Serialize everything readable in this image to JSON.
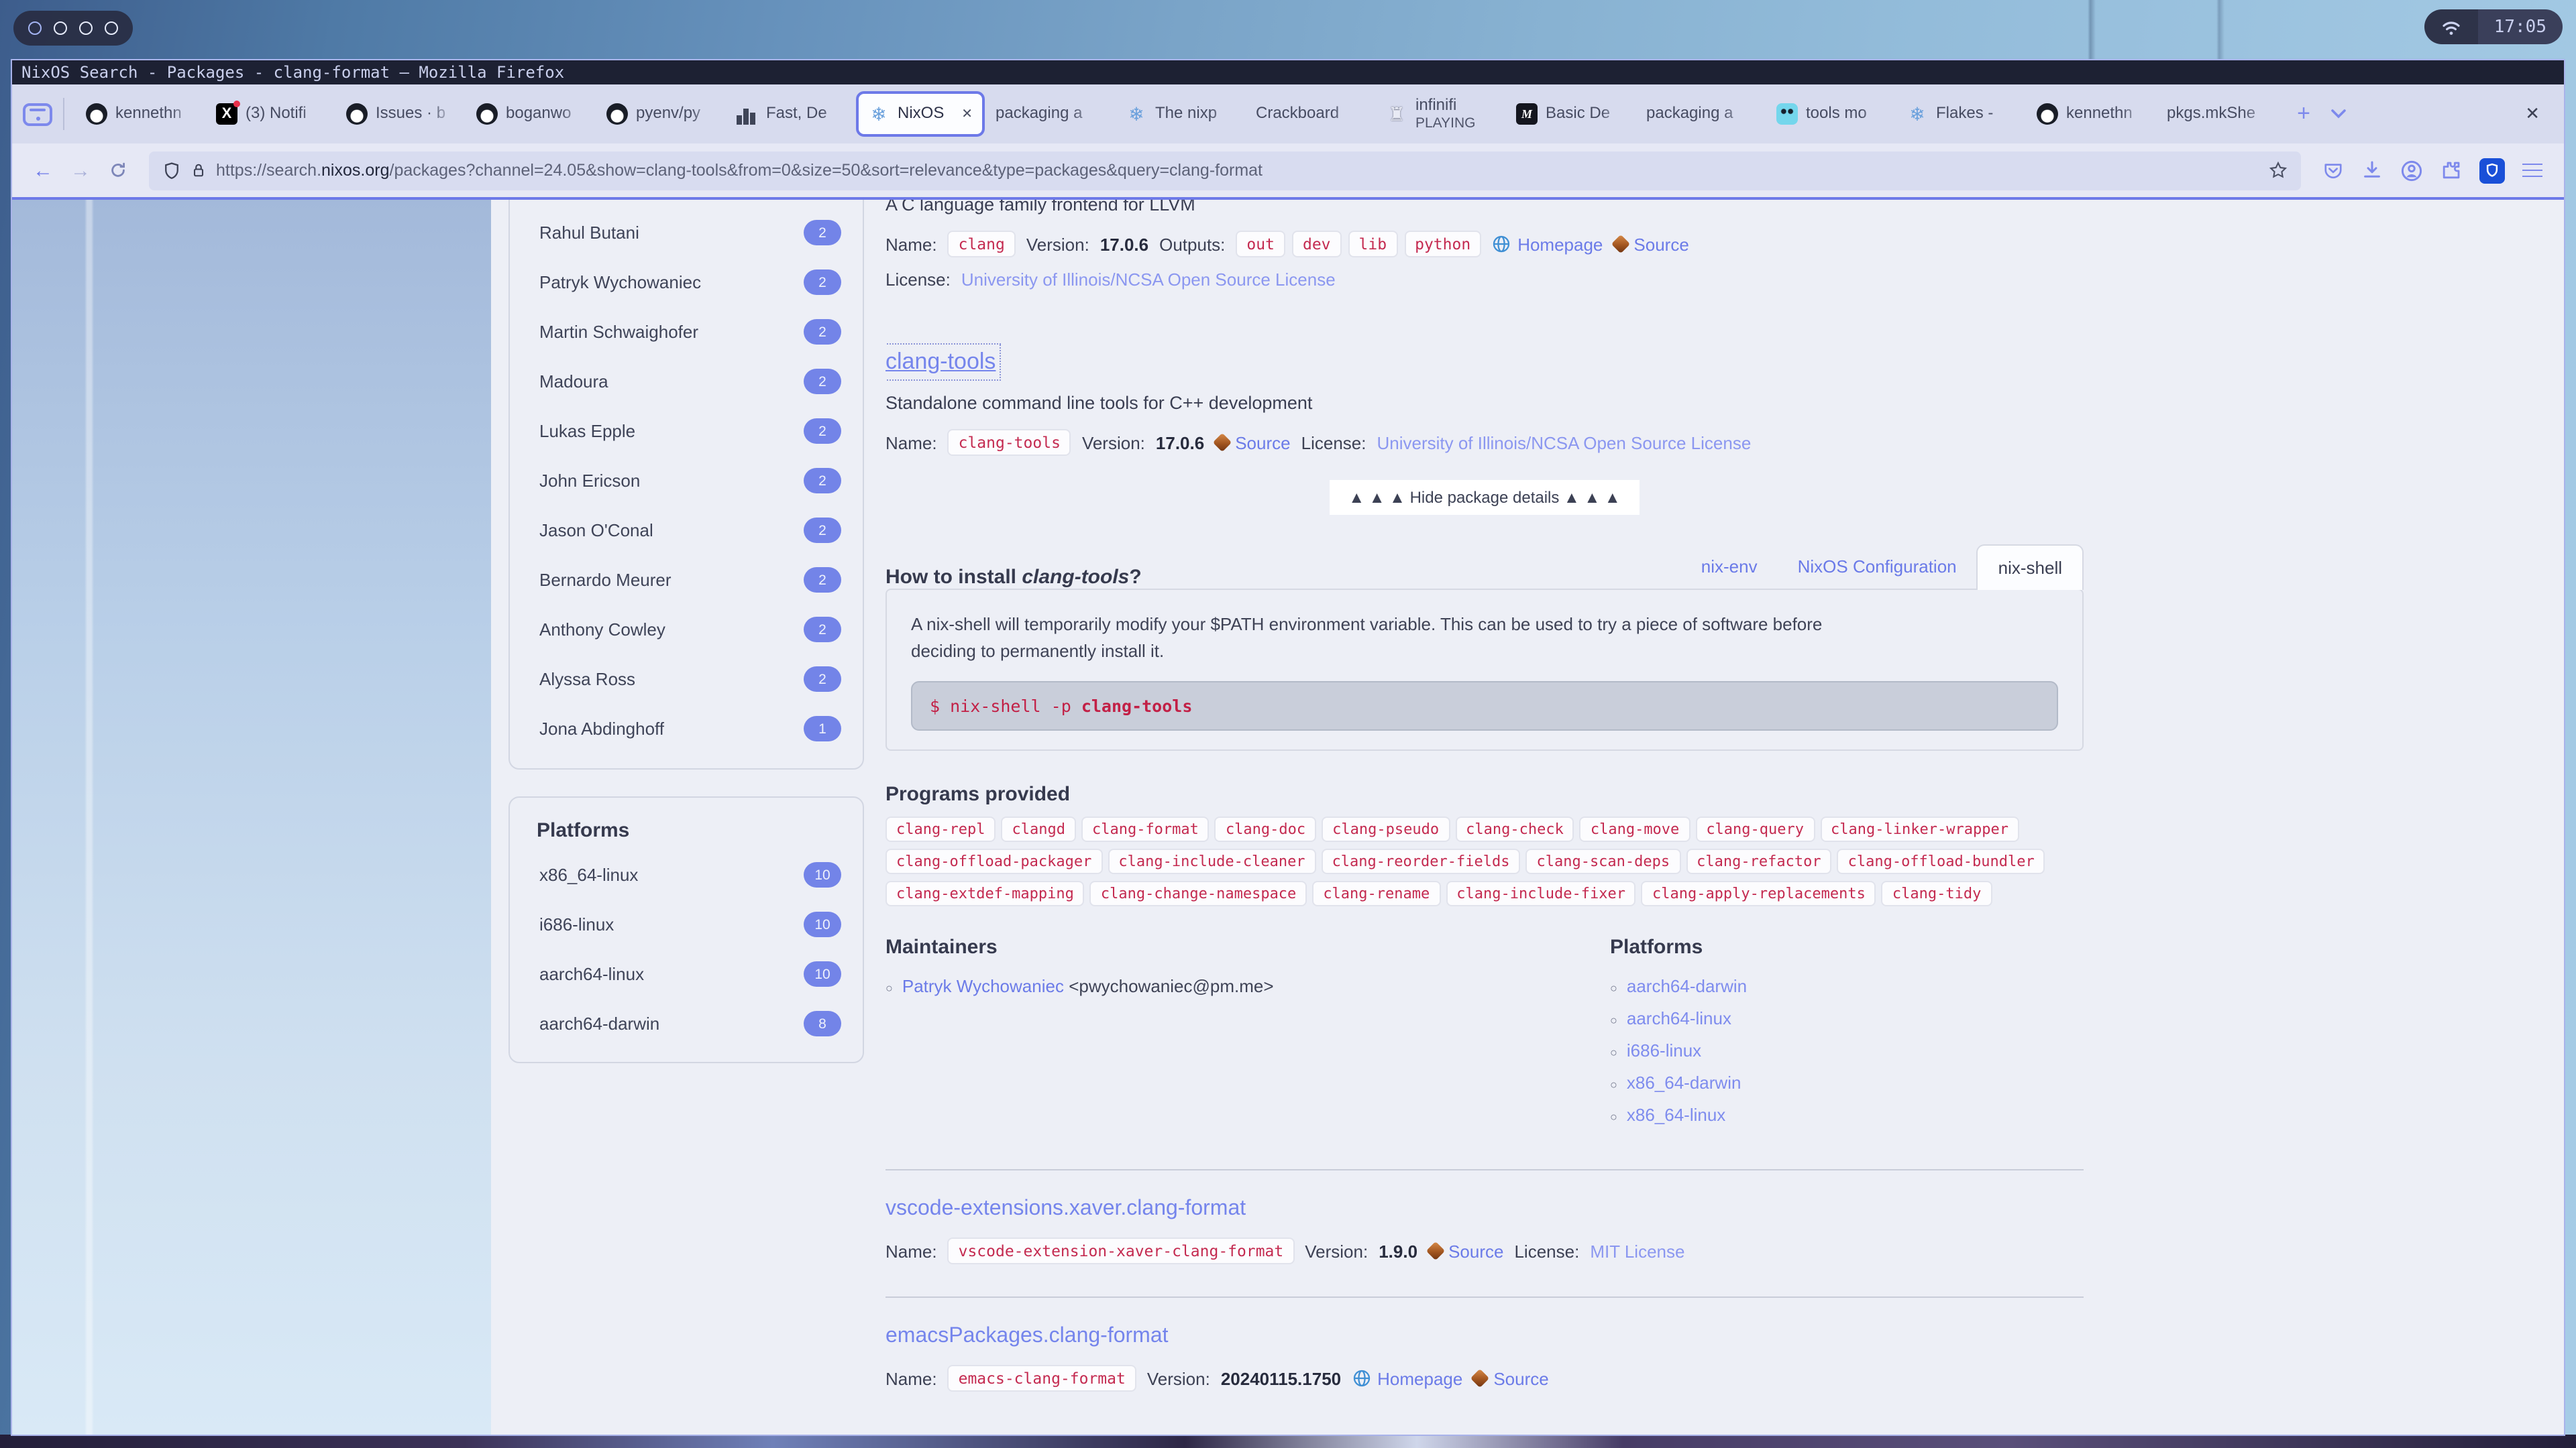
{
  "desktop": {
    "clock": "17:05"
  },
  "window": {
    "title": "NixOS Search - Packages - clang-format — Mozilla Firefox"
  },
  "tabbar": {
    "tabs": [
      {
        "icon": "github",
        "label": "kennethn"
      },
      {
        "icon": "x",
        "label": "(3) Notifi"
      },
      {
        "icon": "github",
        "label": "Issues · b"
      },
      {
        "icon": "github",
        "label": "boganwo"
      },
      {
        "icon": "github",
        "label": "pyenv/py"
      },
      {
        "icon": "chart",
        "label": "Fast, De"
      },
      {
        "icon": "nix",
        "label": "NixOS",
        "active": true,
        "close": "✕"
      },
      {
        "icon": "none",
        "label": "packaging a"
      },
      {
        "icon": "nix",
        "label": "The nixp"
      },
      {
        "icon": "none",
        "label": "Crackboard"
      },
      {
        "icon": "chess",
        "label": "infinifi",
        "sub": "PLAYING"
      },
      {
        "icon": "book",
        "label": "Basic De"
      },
      {
        "icon": "none",
        "label": "packaging a"
      },
      {
        "icon": "gopher",
        "label": "tools mo"
      },
      {
        "icon": "nix",
        "label": "Flakes -"
      },
      {
        "icon": "github",
        "label": "kennethn"
      },
      {
        "icon": "none",
        "label": "pkgs.mkShe"
      }
    ],
    "new_tab": "+",
    "close_window": "✕"
  },
  "navbar": {
    "back": "←",
    "forward": "→",
    "url": {
      "prefix": "https://search.",
      "domain": "nixos.org",
      "rest": "/packages?channel=24.05&show=clang-tools&from=0&size=50&sort=relevance&type=packages&query=clang-format"
    }
  },
  "sidebar": {
    "maintainers": [
      {
        "name": "Rahul Butani",
        "count": "2"
      },
      {
        "name": "Patryk Wychowaniec",
        "count": "2"
      },
      {
        "name": "Martin Schwaighofer",
        "count": "2"
      },
      {
        "name": "Madoura",
        "count": "2"
      },
      {
        "name": "Lukas Epple",
        "count": "2"
      },
      {
        "name": "John Ericson",
        "count": "2"
      },
      {
        "name": "Jason O'Conal",
        "count": "2"
      },
      {
        "name": "Bernardo Meurer",
        "count": "2"
      },
      {
        "name": "Anthony Cowley",
        "count": "2"
      },
      {
        "name": "Alyssa Ross",
        "count": "2"
      },
      {
        "name": "Jona Abdinghoff",
        "count": "1"
      }
    ],
    "platforms": {
      "heading": "Platforms",
      "items": [
        {
          "name": "x86_64-linux",
          "count": "10"
        },
        {
          "name": "i686-linux",
          "count": "10"
        },
        {
          "name": "aarch64-linux",
          "count": "10"
        },
        {
          "name": "aarch64-darwin",
          "count": "8"
        }
      ]
    }
  },
  "labels": {
    "name": "Name:",
    "version": "Version:",
    "outputs": "Outputs:",
    "license": "License:",
    "homepage": "Homepage",
    "source": "Source"
  },
  "results": {
    "clang": {
      "description": "A C language family frontend for LLVM",
      "name": "clang",
      "version": "17.0.6",
      "outputs": [
        "out",
        "dev",
        "lib",
        "python"
      ],
      "license": "University of Illinois/NCSA Open Source License"
    },
    "clang_tools": {
      "title": "clang-tools",
      "description": "Standalone command line tools for C++ development",
      "name": "clang-tools",
      "version": "17.0.6",
      "license": "University of Illinois/NCSA Open Source License",
      "hide_details": "▲ ▲ ▲ Hide package details ▲ ▲ ▲",
      "install": {
        "question_prefix": "How to install ",
        "question_pkg": "clang-tools",
        "question_suffix": "?",
        "tabs": [
          {
            "label": "nix-env"
          },
          {
            "label": "NixOS Configuration"
          },
          {
            "label": "nix-shell",
            "active": true
          }
        ],
        "note": "A nix-shell will temporarily modify your $PATH environment variable. This can be used to try a piece of software before deciding to permanently install it.",
        "command_prompt": "$ ",
        "command": "nix-shell -p ",
        "command_pkg": "clang-tools"
      },
      "programs_heading": "Programs provided",
      "programs": [
        "clang-repl",
        "clangd",
        "clang-format",
        "clang-doc",
        "clang-pseudo",
        "clang-check",
        "clang-move",
        "clang-query",
        "clang-linker-wrapper",
        "clang-offload-packager",
        "clang-include-cleaner",
        "clang-reorder-fields",
        "clang-scan-deps",
        "clang-refactor",
        "clang-offload-bundler",
        "clang-extdef-mapping",
        "clang-change-namespace",
        "clang-rename",
        "clang-include-fixer",
        "clang-apply-replacements",
        "clang-tidy"
      ],
      "maintainers_heading": "Maintainers",
      "maintainer": {
        "name": "Patryk Wychowaniec",
        "email": "<pwychowaniec@pm.me>"
      },
      "platforms_heading": "Platforms",
      "platforms": [
        "aarch64-darwin",
        "aarch64-linux",
        "i686-linux",
        "x86_64-darwin",
        "x86_64-linux"
      ]
    },
    "vscode": {
      "title": "vscode-extensions.xaver.clang-format",
      "name": "vscode-extension-xaver-clang-format",
      "version": "1.9.0",
      "license": "MIT License"
    },
    "emacs": {
      "title": "emacsPackages.clang-format",
      "name": "emacs-clang-format",
      "version": "20240115.1750"
    }
  }
}
